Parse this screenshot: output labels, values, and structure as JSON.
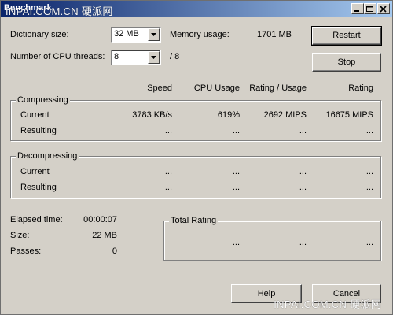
{
  "window": {
    "title": "Benchmark",
    "watermark_top": "INPAI.COM.CN 硬派网",
    "watermark_bottom": "INPAI.COM.CN 硬派网"
  },
  "settings": {
    "dictionary_label": "Dictionary size:",
    "dictionary_value": "32 MB",
    "memory_label": "Memory usage:",
    "memory_value": "1701 MB",
    "threads_label": "Number of CPU threads:",
    "threads_value": "8",
    "threads_total": "/ 8"
  },
  "buttons": {
    "restart": "Restart",
    "stop": "Stop",
    "help": "Help",
    "cancel": "Cancel"
  },
  "columns": {
    "speed": "Speed",
    "cpu_usage": "CPU Usage",
    "rating_usage": "Rating / Usage",
    "rating": "Rating"
  },
  "compressing": {
    "title": "Compressing",
    "current": {
      "label": "Current",
      "speed": "3783 KB/s",
      "cpu": "619%",
      "rating_usage": "2692 MIPS",
      "rating": "16675 MIPS"
    },
    "resulting": {
      "label": "Resulting",
      "speed": "...",
      "cpu": "...",
      "rating_usage": "...",
      "rating": "..."
    }
  },
  "decompressing": {
    "title": "Decompressing",
    "current": {
      "label": "Current",
      "speed": "...",
      "cpu": "...",
      "rating_usage": "...",
      "rating": "..."
    },
    "resulting": {
      "label": "Resulting",
      "speed": "...",
      "cpu": "...",
      "rating_usage": "...",
      "rating": "..."
    }
  },
  "stats": {
    "elapsed_label": "Elapsed time:",
    "elapsed_value": "00:00:07",
    "size_label": "Size:",
    "size_value": "22 MB",
    "passes_label": "Passes:",
    "passes_value": "0"
  },
  "total_rating": {
    "title": "Total Rating",
    "v1": "...",
    "v2": "...",
    "v3": "..."
  },
  "icons": {
    "minimize": "minimize-icon",
    "maximize": "maximize-icon",
    "close": "close-icon",
    "dropdown": "chevron-down-icon"
  }
}
